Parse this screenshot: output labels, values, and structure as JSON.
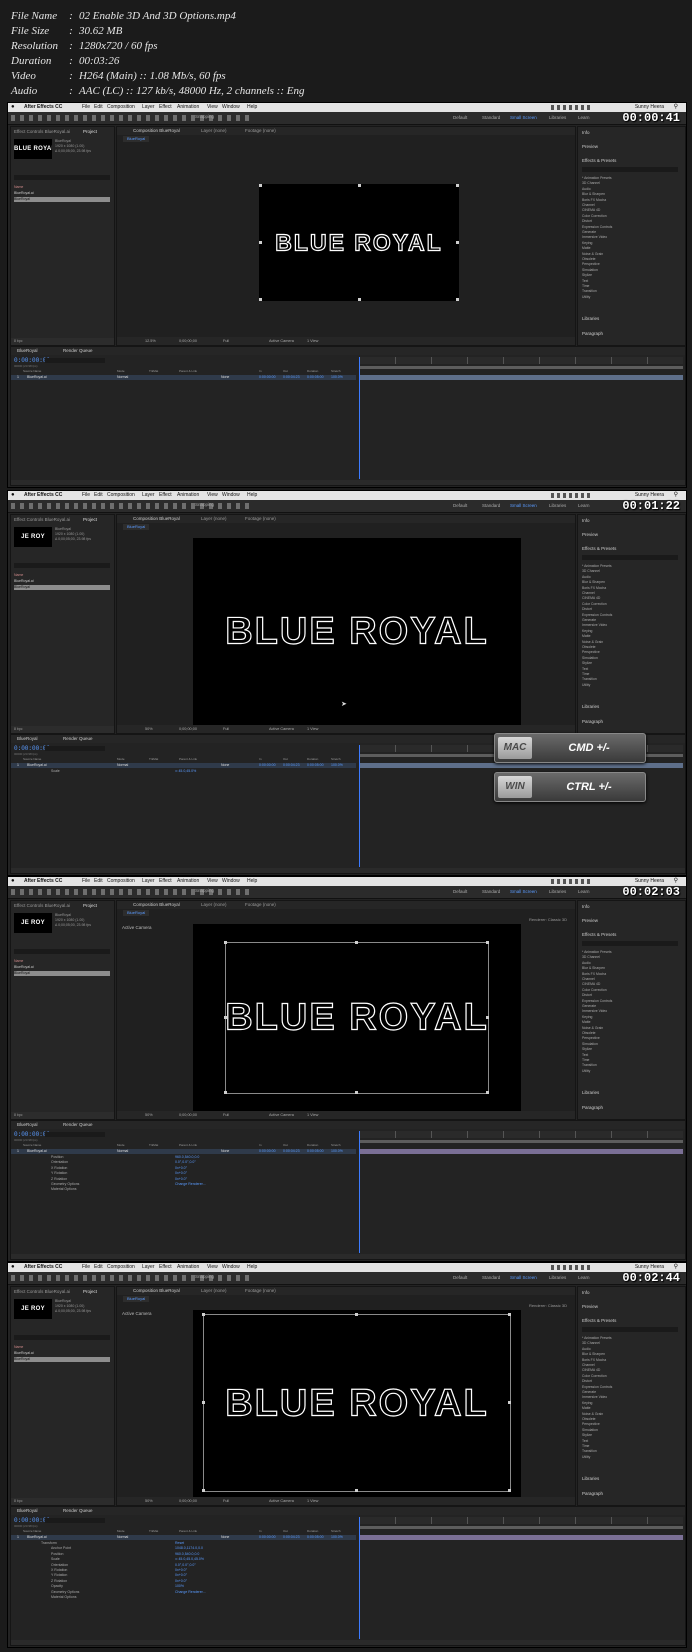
{
  "file_info": [
    {
      "key": "File Name",
      "value": "02 Enable 3D And 3D Options.mp4"
    },
    {
      "key": "File Size",
      "value": "30.62 MB"
    },
    {
      "key": "Resolution",
      "value": "1280x720 / 60 fps"
    },
    {
      "key": "Duration",
      "value": "00:03:26"
    },
    {
      "key": "Video",
      "value": "H264 (Main) :: 1.08 Mb/s, 60 fps"
    },
    {
      "key": "Audio",
      "value": "AAC (LC) :: 127 kb/s, 48000 Hz, 2 channels :: Eng"
    }
  ],
  "app": {
    "name": "After Effects CC",
    "menu": [
      "File",
      "Edit",
      "Composition",
      "Layer",
      "Effect",
      "Animation",
      "View",
      "Window",
      "Help"
    ],
    "user": "Sunny Heera",
    "snapping": "Snapping",
    "workspaces": [
      "Default",
      "Standard",
      "Small Screen",
      "Libraries",
      "Learn"
    ],
    "active_workspace": "Small Screen"
  },
  "panels": {
    "left_tabs": [
      "Effect Controls BlueRoyal.ai",
      "Project"
    ],
    "project_item": "BlueRoyal",
    "project_meta": [
      "1920 x 1080 (1.00)",
      "Δ 0;00;05;00, 23.98 fps"
    ],
    "project_items": [
      "BlueRoyal.ai",
      "BlueRoyal"
    ],
    "project_header": "Name",
    "bpc": "8 bpc",
    "comp_tabs": [
      "Composition BlueRoyal",
      "Layer (none)",
      "Footage (none)"
    ],
    "comp_subtab": "BlueRoyal",
    "active_camera": "Active Camera",
    "renderer": "Renderer:  Classic 3D",
    "view_menu": "1 View",
    "resolution": "Full",
    "logo_text": "BLUE ROYAL",
    "thumb_text_1": "BLUE ROYAL",
    "thumb_text_2": "JE ROY",
    "right": {
      "info": "Info",
      "preview": "Preview",
      "effects": "Effects & Presets",
      "libraries": "Libraries",
      "paragraph": "Paragraph",
      "effects_list": [
        "* Animation Presets",
        "3D Channel",
        "Audio",
        "Blur & Sharpen",
        "Boris FX Mocha",
        "Channel",
        "CINEMA 4D",
        "Color Correction",
        "Distort",
        "Expression Controls",
        "Generate",
        "Immersive Video",
        "Keying",
        "Matte",
        "Noise & Grain",
        "Obsolete",
        "Perspective",
        "Simulation",
        "Stylize",
        "Text",
        "Time",
        "Transition",
        "Utility"
      ]
    },
    "timeline": {
      "comp_tab": "BlueRoyal",
      "render_queue": "Render Queue",
      "timecode": "0:00:00:00",
      "fps": "00000 (23.98 fps)",
      "columns": [
        "Source Name",
        "Mode",
        "TrkMat",
        "Parent & Link",
        "In",
        "Out",
        "Duration",
        "Stretch"
      ],
      "layer": {
        "index": "1",
        "name": "BlueRoyal.ai",
        "mode": "Normal",
        "parent": "None",
        "in": "0:00:00:00",
        "out": "0:00:04:23",
        "duration": "0:00:05:00",
        "stretch": "100.0%"
      }
    }
  },
  "frames": [
    {
      "timer": "00:00:41",
      "zoom": "12.5%",
      "time": "0;00;00;00"
    },
    {
      "timer": "00:01:22",
      "zoom": "50%",
      "time": "0;00;00;00",
      "props": [
        {
          "name": "Scale",
          "value": "∞ 45.0,45.0%"
        }
      ],
      "shortcuts": [
        {
          "os": "MAC",
          "keys": "CMD +/-"
        },
        {
          "os": "WIN",
          "keys": "CTRL +/-"
        }
      ]
    },
    {
      "timer": "00:02:03",
      "zoom": "50%",
      "time": "0;00;00;00",
      "props": [
        {
          "name": "Position",
          "value": "960.0,540.0,0.0"
        },
        {
          "name": "Orientation",
          "value": "0.0°,0.0°,0.0°"
        },
        {
          "name": "X Rotation",
          "value": "0x+0.0°"
        },
        {
          "name": "Y Rotation",
          "value": "0x+0.0°"
        },
        {
          "name": "Z Rotation",
          "value": "0x+0.0°"
        },
        {
          "name": "Geometry Options",
          "value": "Change Renderer..."
        },
        {
          "name": "Material Options",
          "value": ""
        }
      ]
    },
    {
      "timer": "00:02:44",
      "zoom": "50%",
      "time": "0;00;00;00",
      "props": [
        {
          "name": "Transform",
          "value": "Reset"
        },
        {
          "name": "Anchor Point",
          "value": "1048.0,1174.0,0.0"
        },
        {
          "name": "Position",
          "value": "960.0,540.0,0.0"
        },
        {
          "name": "Scale",
          "value": "∞ 45.0,45.0,45.0%"
        },
        {
          "name": "Orientation",
          "value": "0.0°,0.0°,0.0°"
        },
        {
          "name": "X Rotation",
          "value": "0x+0.0°"
        },
        {
          "name": "Y Rotation",
          "value": "0x+0.0°"
        },
        {
          "name": "Z Rotation",
          "value": "0x+0.0°"
        },
        {
          "name": "Opacity",
          "value": "100%"
        },
        {
          "name": "Geometry Options",
          "value": "Change Renderer..."
        },
        {
          "name": "Material Options",
          "value": ""
        }
      ]
    }
  ]
}
